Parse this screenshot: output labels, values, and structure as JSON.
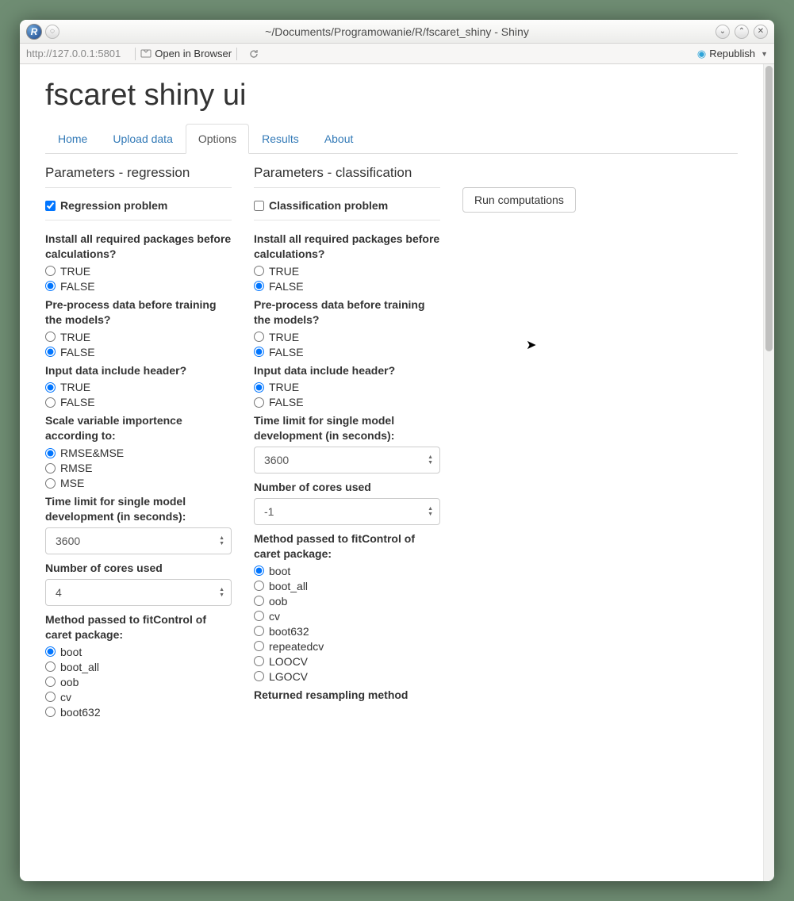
{
  "window": {
    "title": "~/Documents/Programowanie/R/fscaret_shiny - Shiny",
    "url": "http://127.0.0.1:5801",
    "open_browser": "Open in Browser",
    "republish": "Republish"
  },
  "app": {
    "title": "fscaret shiny ui",
    "tabs": [
      "Home",
      "Upload data",
      "Options",
      "Results",
      "About"
    ],
    "active_tab": "Options",
    "run_button": "Run computations"
  },
  "reg": {
    "section": "Parameters - regression",
    "checkbox": "Regression problem",
    "checkbox_checked": true,
    "install_label": "Install all required packages before calculations?",
    "preprocess_label": "Pre-process data before training the models?",
    "header_label": "Input data include header?",
    "scale_label": "Scale variable importence according to:",
    "scale_opts": [
      "RMSE&MSE",
      "RMSE",
      "MSE"
    ],
    "scale_selected": "RMSE&MSE",
    "timelimit_label": "Time limit for single model development (in seconds):",
    "timelimit_value": "3600",
    "cores_label": "Number of cores used",
    "cores_value": "4",
    "method_label": "Method passed to fitControl of caret package:",
    "method_opts": [
      "boot",
      "boot_all",
      "oob",
      "cv",
      "boot632"
    ],
    "method_selected": "boot"
  },
  "cls": {
    "section": "Parameters - classification",
    "checkbox": "Classification problem",
    "checkbox_checked": false,
    "install_label": "Install all required packages before calculations?",
    "preprocess_label": "Pre-process data before training the models?",
    "header_label": "Input data include header?",
    "timelimit_label": "Time limit for single model development (in seconds):",
    "timelimit_value": "3600",
    "cores_label": "Number of cores used",
    "cores_value": "-1",
    "method_label": "Method passed to fitControl of caret package:",
    "method_opts": [
      "boot",
      "boot_all",
      "oob",
      "cv",
      "boot632",
      "repeatedcv",
      "LOOCV",
      "LGOCV"
    ],
    "method_selected": "boot",
    "returned_label": "Returned resampling method"
  },
  "tf": {
    "t": "TRUE",
    "f": "FALSE"
  }
}
